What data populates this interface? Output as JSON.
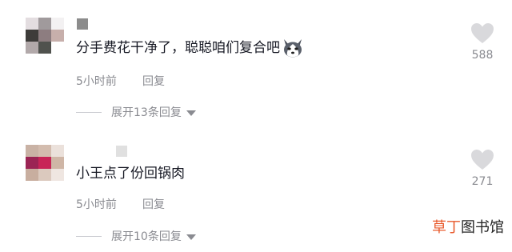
{
  "comments": [
    {
      "avatar_colors": [
        "#e3dde0",
        "#a09a9c",
        "#f3f1f2",
        "#3e3c3a",
        "#8d7d80",
        "#c7afab",
        "#b2a9aa",
        "#50524e",
        "#ffffff"
      ],
      "username_color": "#8c8c8c",
      "text": "分手费花干净了，聪聪咱们复合吧",
      "emoji": "husky-face-icon",
      "time": "5小时前",
      "reply_label": "回复",
      "expand_label": "展开13条回复",
      "likes": "588"
    },
    {
      "avatar_colors": [
        "#c9b2a5",
        "#d3bcae",
        "#ebe1db",
        "#9b2454",
        "#c82457",
        "#cfb6a6",
        "#c8ae9f",
        "#dbc9be",
        "#efe6e1"
      ],
      "username_color": "#e0e0e0",
      "text": "小王点了份回锅肉",
      "emoji": "",
      "time": "5小时前",
      "reply_label": "回复",
      "expand_label": "展开10条回复",
      "likes": "271"
    }
  ],
  "watermark": {
    "accent_part": "草丁",
    "rest": "图书馆"
  },
  "colors": {
    "heart": "#d9d9dc",
    "meta": "#8a8b91",
    "accent": "#e8592b"
  }
}
